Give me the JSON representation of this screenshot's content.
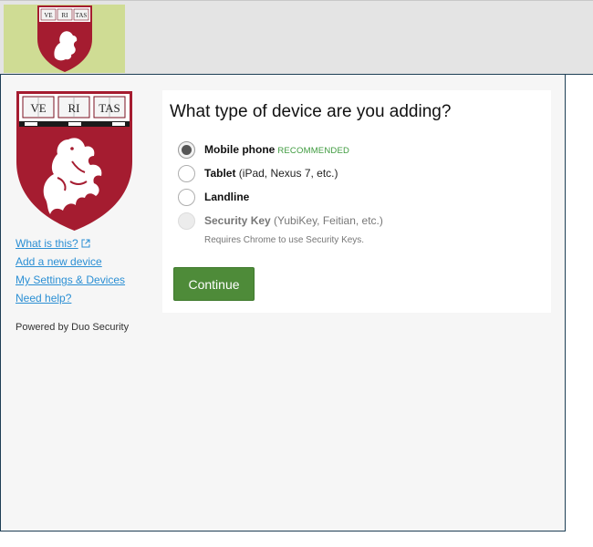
{
  "colors": {
    "crimson": "#a51c30",
    "continue_button": "#4e8b39",
    "link": "#2b8fd4",
    "recommended": "#3d9a3d"
  },
  "shield": {
    "motto": [
      "VE",
      "RI",
      "TAS"
    ]
  },
  "sidebar": {
    "links": [
      {
        "label": "What is this?",
        "icon": "external-link-icon"
      },
      {
        "label": "Add a new device"
      },
      {
        "label": "My Settings & Devices"
      },
      {
        "label": "Need help?"
      }
    ],
    "powered_by": "Powered by Duo Security"
  },
  "main": {
    "title": "What type of device are you adding?",
    "options": [
      {
        "label": "Mobile phone",
        "note": "",
        "badge": "RECOMMENDED",
        "selected": true,
        "disabled": false
      },
      {
        "label": "Tablet",
        "note": " (iPad, Nexus 7, etc.)",
        "badge": "",
        "selected": false,
        "disabled": false
      },
      {
        "label": "Landline",
        "note": "",
        "badge": "",
        "selected": false,
        "disabled": false
      },
      {
        "label": "Security Key",
        "note": " (YubiKey, Feitian, etc.)",
        "badge": "",
        "selected": false,
        "disabled": true
      }
    ],
    "security_key_note": "Requires Chrome to use Security Keys.",
    "continue_label": "Continue"
  }
}
